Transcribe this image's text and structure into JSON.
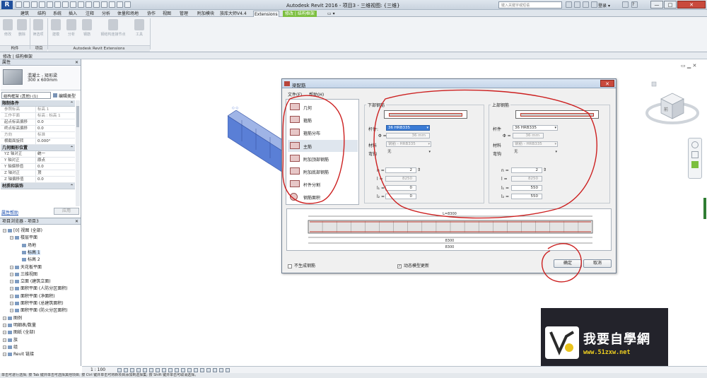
{
  "app": {
    "title": "Autodesk Revit 2016 -",
    "document": "项目3 - 三维视图: {三维}",
    "search_placeholder": "键入关键字或短语",
    "login": "登录",
    "logo": "R",
    "win_min": "—",
    "win_max": "□",
    "win_close": "✕",
    "help": "?",
    "dropdown_glyph": "▾"
  },
  "ribbon": {
    "tabs": [
      "建筑",
      "结构",
      "系统",
      "插入",
      "注释",
      "分析",
      "体量和场地",
      "协作",
      "视图",
      "管理",
      "附加模块",
      "族库大师V4.4",
      "Extensions",
      "修改 | 结构框架"
    ],
    "buttons": [
      "修改",
      "删除",
      "筛选项",
      "建模",
      "分析",
      "钢筋",
      "钢结构连接节点",
      "工具"
    ],
    "panels": [
      "构件",
      "项目",
      "Autodesk Revit Extensions"
    ]
  },
  "context_bar": "修改 | 结构框架",
  "properties": {
    "header": "属性",
    "close_glyph": "✕",
    "type_name_1": "混凝土 - 矩形梁",
    "type_name_2": "300 x 600mm",
    "instance_selector": "结构框架 (其他) (1)",
    "edit_type": "编辑类型",
    "collapse_glyph": "⌃",
    "sections": [
      {
        "title": "限制条件",
        "rows": [
          {
            "k": "参照标高",
            "v": "标高 1",
            "dim": true
          },
          {
            "k": "工作平面",
            "v": "标高 : 标高 1",
            "dim": true
          },
          {
            "k": "起点标高偏移",
            "v": "0.0",
            "dim": false
          },
          {
            "k": "终点标高偏移",
            "v": "0.0",
            "dim": false
          },
          {
            "k": "方向",
            "v": "标准",
            "dim": true
          },
          {
            "k": "横截面旋转",
            "v": "0.000°",
            "dim": false
          }
        ]
      },
      {
        "title": "几何图形位置",
        "rows": [
          {
            "k": "YZ 轴对正",
            "v": "统一",
            "dim": false
          },
          {
            "k": "Y 轴对正",
            "v": "原点",
            "dim": false
          },
          {
            "k": "Y 轴偏移值",
            "v": "0.0",
            "dim": false
          },
          {
            "k": "Z 轴对正",
            "v": "顶",
            "dim": false
          },
          {
            "k": "Z 轴偏移值",
            "v": "0.0",
            "dim": false
          }
        ]
      },
      {
        "title": "材质和装饰",
        "rows": []
      }
    ],
    "help_link": "属性帮助",
    "apply": "应用"
  },
  "browser": {
    "header": "项目浏览器 - 项目3",
    "close_glyph": "✕",
    "items": [
      {
        "t": "[0] 视图 (全部)",
        "l": 0
      },
      {
        "t": "楼层平面",
        "l": 1
      },
      {
        "t": "场地",
        "l": 2
      },
      {
        "t": "标高 1",
        "l": 2,
        "sel": true
      },
      {
        "t": "标高 2",
        "l": 2
      },
      {
        "t": "天花板平面",
        "l": 1
      },
      {
        "t": "三维视图",
        "l": 1
      },
      {
        "t": "立面 (建筑立面)",
        "l": 1
      },
      {
        "t": "面积平面 (人防分区面积)",
        "l": 1
      },
      {
        "t": "面积平面 (净面积)",
        "l": 1
      },
      {
        "t": "面积平面 (总建筑面积)",
        "l": 1
      },
      {
        "t": "面积平面 (防火分区面积)",
        "l": 1
      },
      {
        "t": "图例",
        "l": 0
      },
      {
        "t": "明细表/数量",
        "l": 0
      },
      {
        "t": "图纸 (全部)",
        "l": 0
      },
      {
        "t": "族",
        "l": 0
      },
      {
        "t": "组",
        "l": 0
      },
      {
        "t": "Revit 链接",
        "l": 0
      }
    ]
  },
  "dialog": {
    "title": "梁配筋",
    "close": "✕",
    "menu": [
      "文件(F)",
      "帮助(H)"
    ],
    "categories": [
      "几何",
      "箍筋",
      "箍筋分布",
      "主筋",
      "附加顶部钢筋",
      "附加底部钢筋",
      "杆件分割",
      "钢筋面积"
    ],
    "active_category": 3,
    "bottom_bars": {
      "title": "下部钢筋",
      "bar_label": "杆件:",
      "bar_value": "36 HRB335",
      "phi_label": "Φ =",
      "phi_value": "36 mm",
      "material_label": "材料",
      "material_value": "钢筋 - HRB335",
      "hook_label": "弯钩",
      "hook_value": "无",
      "params": [
        {
          "k": "n =",
          "v": "2"
        },
        {
          "k": "l =",
          "v": "8250"
        },
        {
          "k": "l₁ =",
          "v": "0"
        },
        {
          "k": "l₂ =",
          "v": "0"
        }
      ]
    },
    "top_bars": {
      "title": "上部钢筋",
      "bar_label": "杆件",
      "bar_value": "36 HRB335",
      "phi_label": "Φ =",
      "phi_value": "36 mm",
      "material_label": "材料",
      "material_value": "钢筋 - HRB335",
      "hook_label": "弯钩",
      "hook_value": "无",
      "params": [
        {
          "k": "n =",
          "v": "2"
        },
        {
          "k": "l =",
          "v": "8250"
        },
        {
          "k": "l₁ =",
          "v": "550"
        },
        {
          "k": "l₂ =",
          "v": "550"
        }
      ]
    },
    "preview": {
      "top_dim": "L=8300",
      "dim1": "8300",
      "dim2": "8300"
    },
    "check_no_rebar": "不生成钢筋",
    "check_dynamic": "动态模型更新",
    "ok": "确定",
    "cancel": "取消",
    "check_glyph": "✓"
  },
  "view_control": {
    "scale": "1 : 100"
  },
  "status_bar": "单击可进行选择; 按 Tab 键并单击可选择其他项目; 按 Ctrl 键并单击可将新项目添加到选择集; 按 Shift 键并单击可取消选择。",
  "watermark": {
    "cn": "我要自學網",
    "url": "www.51zxw.net"
  },
  "viewcube": {
    "face": "前"
  },
  "colors": {
    "accent": "#7cbf3f",
    "annotation": "#cc1f1f",
    "beam": "#5a7fd6"
  }
}
